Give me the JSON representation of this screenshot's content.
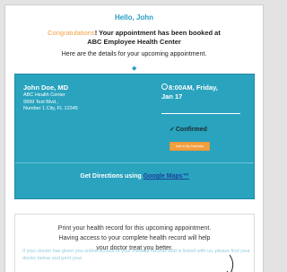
{
  "header": {
    "greeting": "Hello, John",
    "congrats_word": "Congratulations",
    "booked_text": "! Your appointment has been booked at",
    "center_name": "ABC Employee Health Center",
    "details_line": "Here are the details for your upcoming appointment."
  },
  "appointment": {
    "doctor_name": "John Doe, MD",
    "address_lines": [
      "ABC Health Center",
      "9999 Test Blvd.,",
      "Number 1 City, FL 12345"
    ],
    "time": "8:00AM, Friday,",
    "date": "Jan 17",
    "status": "Confirmed",
    "calendar_button": "Add to My Calendar",
    "directions_prefix": "Get Directions using ",
    "directions_link": "Google Maps™"
  },
  "record": {
    "lines": [
      "Print your health record for this upcoming appointment.",
      "Having access to your complete health record will help",
      "your doctor treat you better."
    ],
    "faded_text": "If your doctor has given you online access to your medical records and is linked with us, please find your doctor below and print your"
  },
  "colors": {
    "accent": "#2aa3bf",
    "orange": "#f0a040",
    "link": "#1b3f9a"
  },
  "icons": [
    "clock-icon",
    "check-icon",
    "arrow-icon"
  ]
}
